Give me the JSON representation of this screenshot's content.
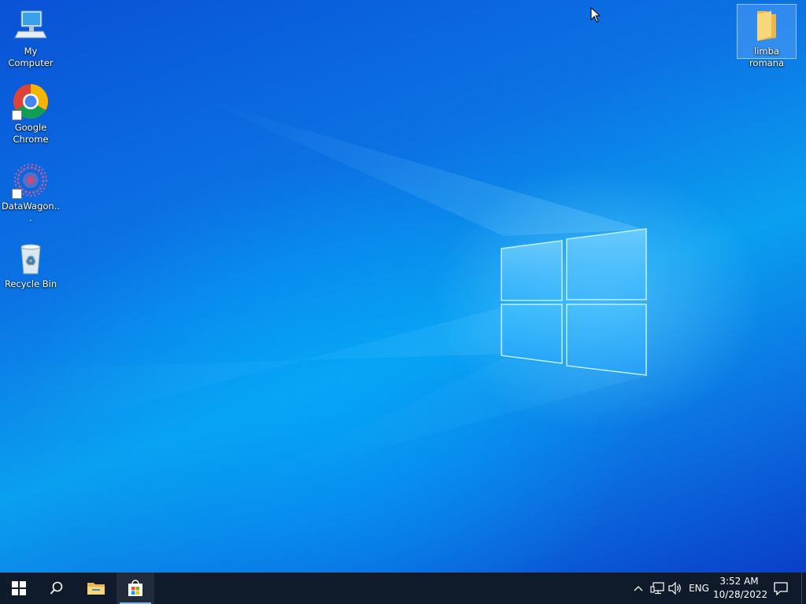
{
  "desktop": {
    "icons": [
      {
        "label": "My Computer",
        "icon": "computer-icon"
      },
      {
        "label": "Google Chrome",
        "icon": "chrome-icon",
        "shortcut": true
      },
      {
        "label": "DataWagon...",
        "icon": "datawagon-icon",
        "shortcut": true
      },
      {
        "label": "Recycle Bin",
        "icon": "recycle-bin-icon"
      },
      {
        "label": "limba romana",
        "icon": "folder-icon",
        "selected": true
      }
    ]
  },
  "taskbar": {
    "start_icon": "windows-start-icon",
    "search_icon": "search-icon",
    "pinned": [
      {
        "name": "file-explorer",
        "icon": "folder-icon"
      },
      {
        "name": "microsoft-store",
        "icon": "store-icon",
        "active": true
      }
    ],
    "tray": {
      "chevron_icon": "chevron-up-icon",
      "network_icon": "network-icon",
      "volume_icon": "volume-icon",
      "language": "ENG",
      "time": "3:52 AM",
      "date": "10/28/2022",
      "notification_icon": "notification-icon"
    }
  },
  "colors": {
    "accent": "#76b9ed",
    "taskbar": "#0f1a2a",
    "wallpaper_blue": "#0b74e4"
  }
}
